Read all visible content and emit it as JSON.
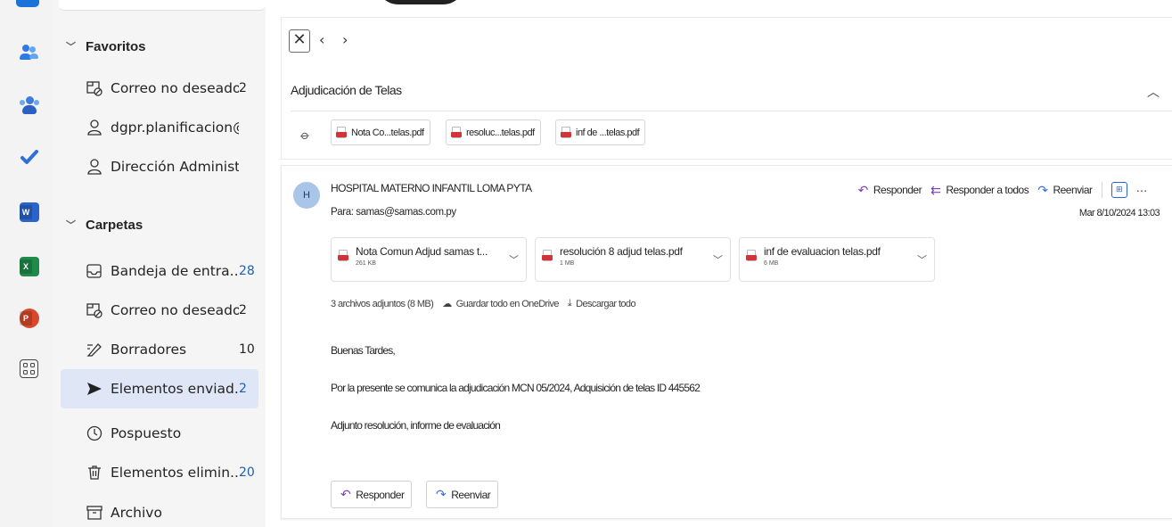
{
  "rail": {
    "icons": [
      "mail-icon",
      "people-icon",
      "groups-icon",
      "todo-icon",
      "word-icon",
      "excel-icon",
      "powerpoint-icon",
      "more-apps-icon"
    ],
    "word_letter": "W",
    "excel_letter": "X",
    "ppt_letter": "P"
  },
  "folders": {
    "favorites": {
      "title": "Favoritos",
      "items": [
        {
          "label": "Correo no deseado",
          "count": "2",
          "icon": "junk-icon"
        },
        {
          "label": "dgpr.planificacion@g...",
          "count": "",
          "icon": "person-icon"
        },
        {
          "label": "Dirección Administrat...",
          "count": "",
          "icon": "person-icon"
        }
      ]
    },
    "folders_section": {
      "title": "Carpetas",
      "items": [
        {
          "label": "Bandeja de entra...",
          "count": "28",
          "icon": "inbox-icon"
        },
        {
          "label": "Correo no deseado",
          "count": "2",
          "icon": "junk-icon"
        },
        {
          "label": "Borradores",
          "count": "10",
          "icon": "drafts-icon"
        },
        {
          "label": "Elementos enviad...",
          "count": "2",
          "icon": "sent-icon"
        },
        {
          "label": "Pospuesto",
          "count": "",
          "icon": "clock-icon"
        },
        {
          "label": "Elementos elimin...",
          "count": "20",
          "icon": "trash-icon"
        },
        {
          "label": "Archivo",
          "count": "",
          "icon": "archive-icon"
        }
      ]
    }
  },
  "reader": {
    "subject": "Adjudicación de Telas",
    "attachments_strip": [
      {
        "name": "Nota Co...telas.pdf"
      },
      {
        "name": "resoluc...telas.pdf"
      },
      {
        "name": "inf de ...telas.pdf"
      }
    ],
    "message": {
      "avatar_letter": "H",
      "sender": "HOSPITAL MATERNO INFANTIL LOMA PYTA",
      "to": "Para: samas@samas.com.py",
      "date": "Mar 8/10/2024 13:03",
      "actions": {
        "reply": "Responder",
        "reply_all": "Responder a todos",
        "forward": "Reenviar"
      },
      "attachments": [
        {
          "name": "Nota Comun Adjud samas t...",
          "size": "261 KB"
        },
        {
          "name": "resolución 8 adjud telas.pdf",
          "size": "1 MB"
        },
        {
          "name": "inf de evaluacion telas.pdf",
          "size": "6 MB"
        }
      ],
      "attachments_summary": "3 archivos adjuntos (8 MB)",
      "save_onedrive": "Guardar todo en OneDrive",
      "download_all": "Descargar todo",
      "body": [
        "Buenas Tardes,",
        "Por la presente se comunica la adjudicación MCN 05/2024, Adquisición de telas ID 445562",
        "Adjunto resolución, informe de evaluación"
      ],
      "footer_reply": "Responder",
      "footer_forward": "Reenviar"
    }
  }
}
